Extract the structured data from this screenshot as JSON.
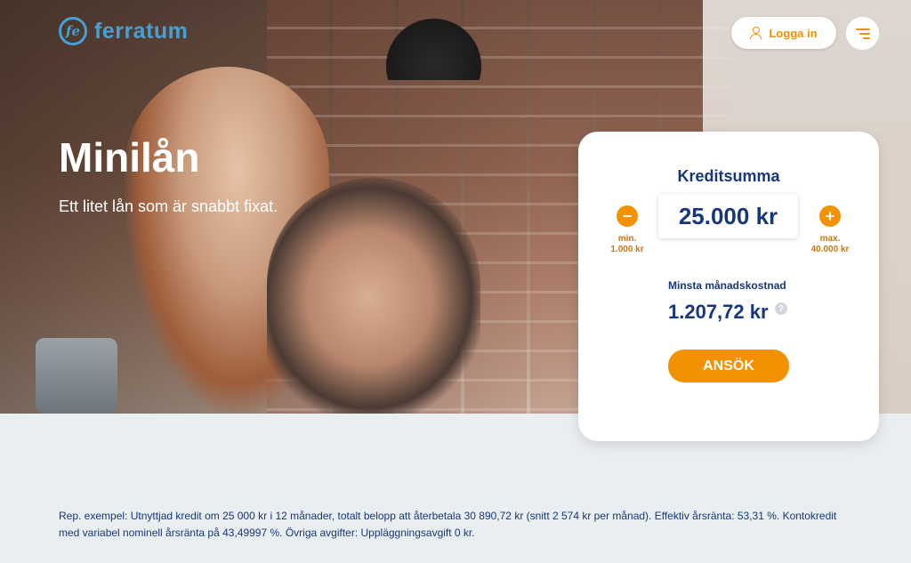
{
  "brand": {
    "logo_mark": "fe",
    "name": "ferratum",
    "color": "#45a0d6"
  },
  "header": {
    "login_label": "Logga in",
    "accent": "#f39200"
  },
  "hero": {
    "title": "Minilån",
    "subtitle": "Ett litet lån som är snabbt fixat."
  },
  "calculator": {
    "title": "Kreditsumma",
    "amount": "25.000 kr",
    "minus_symbol": "−",
    "plus_symbol": "+",
    "min_label": "min.",
    "min_value": "1.000 kr",
    "max_label": "max.",
    "max_value": "40.000 kr",
    "monthly_label": "Minsta månadskostnad",
    "monthly_value": "1.207,72 kr",
    "help_symbol": "?",
    "apply_label": "ANSÖK"
  },
  "disclaimer": {
    "line1": "Rep. exempel: Utnyttjad kredit om 25 000 kr i 12 månader, totalt belopp att återbetala 30 890,72 kr (snitt 2 574 kr per månad). Effektiv årsränta: 53,31 %. Kontokredit",
    "line2": "med variabel nominell årsränta på 43,49997 %. Övriga avgifter: Uppläggningsavgift 0 kr."
  },
  "icons": [
    "user-icon",
    "menu-icon",
    "help-icon",
    "minus-icon",
    "plus-icon"
  ]
}
